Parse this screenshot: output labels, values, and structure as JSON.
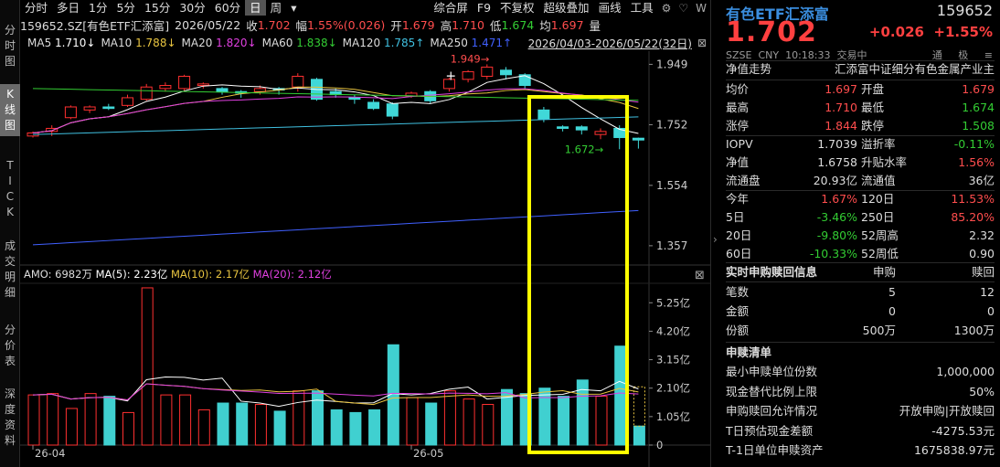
{
  "sidebar": [
    {
      "label": "分时图",
      "lines": [
        "分",
        "时",
        "图"
      ],
      "active": false
    },
    {
      "label": "K线图",
      "lines": [
        "K",
        "线",
        "图"
      ],
      "active": true
    },
    {
      "label": "TICK",
      "lines": [
        "T",
        "I",
        "C",
        "K"
      ],
      "active": false
    },
    {
      "label": "成交明细",
      "lines": [
        "成",
        "交",
        "明",
        "细"
      ],
      "active": false
    },
    {
      "label": "分价表",
      "lines": [
        "分",
        "价",
        "表"
      ],
      "active": false
    },
    {
      "label": "深度资料",
      "lines": [
        "深",
        "度",
        "资",
        "料"
      ],
      "active": false
    }
  ],
  "toolbar": {
    "periods": [
      "分时",
      "多日",
      "1分",
      "5分",
      "15分",
      "30分",
      "60分",
      "日",
      "周"
    ],
    "active_period": "日",
    "more": "▾",
    "tools": [
      "综合屏",
      "F9",
      "不复权",
      "超级叠加",
      "画线",
      "工具"
    ],
    "icons": [
      "gear-icon",
      "heart-icon",
      "w-icon"
    ]
  },
  "info": {
    "code": "159652.SZ[有色ETF汇添富]",
    "date": "2026/05/22",
    "close_label": "收",
    "close": "1.702",
    "amp_label": "幅",
    "amp": "1.55%(0.026)",
    "open_label": "开",
    "open": "1.679",
    "high_label": "高",
    "high": "1.710",
    "low_label": "低",
    "low": "1.674",
    "avg_label": "均",
    "avg": "1.697",
    "vol_label": "量"
  },
  "ma": {
    "items": [
      {
        "label": "MA5",
        "value": "1.710",
        "arrow": "↓",
        "color": "#ffffff"
      },
      {
        "label": "MA10",
        "value": "1.788",
        "arrow": "↓",
        "color": "#e8c440"
      },
      {
        "label": "MA20",
        "value": "1.820",
        "arrow": "↓",
        "color": "#e040e0"
      },
      {
        "label": "MA60",
        "value": "1.838",
        "arrow": "↓",
        "color": "#33cc33"
      },
      {
        "label": "MA120",
        "value": "1.785",
        "arrow": "↑",
        "color": "#40c0e0"
      },
      {
        "label": "MA250",
        "value": "1.471",
        "arrow": "↑",
        "color": "#4060ff"
      }
    ],
    "range": "2026/04/03-2026/05/22(32日)"
  },
  "chart_data": {
    "type": "candlestick",
    "price_ticks": [
      "1.949",
      "1.752",
      "1.554",
      "1.357"
    ],
    "vol_ticks": [
      "5.25亿",
      "4.20亿",
      "3.15亿",
      "2.10亿",
      "1.05亿",
      "0"
    ],
    "x_labels": [
      "26-04",
      "26-05"
    ],
    "high_marker": "1.949",
    "low_marker": "1.672",
    "candles": [
      {
        "o": 1.715,
        "c": 1.725,
        "h": 1.73,
        "l": 1.71,
        "v": 1.85
      },
      {
        "o": 1.73,
        "c": 1.74,
        "h": 1.75,
        "l": 1.715,
        "v": 1.9
      },
      {
        "o": 1.775,
        "c": 1.81,
        "h": 1.815,
        "l": 1.77,
        "v": 1.35
      },
      {
        "o": 1.8,
        "c": 1.81,
        "h": 1.815,
        "l": 1.79,
        "v": 1.9
      },
      {
        "o": 1.81,
        "c": 1.805,
        "h": 1.82,
        "l": 1.8,
        "v": 1.8
      },
      {
        "o": 1.815,
        "c": 1.84,
        "h": 1.85,
        "l": 1.81,
        "v": 1.2
      },
      {
        "o": 1.835,
        "c": 1.875,
        "h": 1.885,
        "l": 1.83,
        "v": 5.8
      },
      {
        "o": 1.87,
        "c": 1.88,
        "h": 1.89,
        "l": 1.86,
        "v": 1.85
      },
      {
        "o": 1.87,
        "c": 1.91,
        "h": 1.915,
        "l": 1.86,
        "v": 1.85
      },
      {
        "o": 1.88,
        "c": 1.885,
        "h": 1.89,
        "l": 1.87,
        "v": 1.3
      },
      {
        "o": 1.87,
        "c": 1.86,
        "h": 1.875,
        "l": 1.85,
        "v": 1.55
      },
      {
        "o": 1.86,
        "c": 1.855,
        "h": 1.865,
        "l": 1.84,
        "v": 1.55
      },
      {
        "o": 1.86,
        "c": 1.87,
        "h": 1.88,
        "l": 1.85,
        "v": 1.5
      },
      {
        "o": 1.87,
        "c": 1.865,
        "h": 1.875,
        "l": 1.85,
        "v": 1.25
      },
      {
        "o": 1.875,
        "c": 1.91,
        "h": 1.92,
        "l": 1.86,
        "v": 2.0
      },
      {
        "o": 1.9,
        "c": 1.835,
        "h": 1.905,
        "l": 1.83,
        "v": 2.0
      },
      {
        "o": 1.86,
        "c": 1.85,
        "h": 1.87,
        "l": 1.84,
        "v": 1.3
      },
      {
        "o": 1.84,
        "c": 1.835,
        "h": 1.85,
        "l": 1.82,
        "v": 1.2
      },
      {
        "o": 1.825,
        "c": 1.805,
        "h": 1.835,
        "l": 1.8,
        "v": 1.3
      },
      {
        "o": 1.82,
        "c": 1.78,
        "h": 1.825,
        "l": 1.77,
        "v": 3.7
      },
      {
        "o": 1.845,
        "c": 1.855,
        "h": 1.86,
        "l": 1.84,
        "v": 1.75
      },
      {
        "o": 1.86,
        "c": 1.83,
        "h": 1.865,
        "l": 1.82,
        "v": 1.55
      },
      {
        "o": 1.87,
        "c": 1.9,
        "h": 1.905,
        "l": 1.86,
        "v": 2.0
      },
      {
        "o": 1.9,
        "c": 1.925,
        "h": 1.93,
        "l": 1.89,
        "v": 1.7
      },
      {
        "o": 1.91,
        "c": 1.94,
        "h": 1.949,
        "l": 1.9,
        "v": 1.5
      },
      {
        "o": 1.93,
        "c": 1.915,
        "h": 1.94,
        "l": 1.9,
        "v": 2.05
      },
      {
        "o": 1.915,
        "c": 1.88,
        "h": 1.92,
        "l": 1.87,
        "v": 1.9
      },
      {
        "o": 1.8,
        "c": 1.77,
        "h": 1.81,
        "l": 1.76,
        "v": 2.1
      },
      {
        "o": 1.745,
        "c": 1.74,
        "h": 1.75,
        "l": 1.73,
        "v": 1.8
      },
      {
        "o": 1.745,
        "c": 1.735,
        "h": 1.75,
        "l": 1.72,
        "v": 2.4
      },
      {
        "o": 1.72,
        "c": 1.73,
        "h": 1.74,
        "l": 1.705,
        "v": 1.8
      },
      {
        "o": 1.74,
        "c": 1.71,
        "h": 1.75,
        "l": 1.672,
        "v": 3.65
      },
      {
        "o": 1.708,
        "c": 1.702,
        "h": 1.71,
        "l": 1.674,
        "v": 0.7
      }
    ]
  },
  "amo": {
    "label": "AMO:",
    "value": "6982万",
    "ma5": "MA(5): 2.23亿",
    "ma10": "MA(10): 2.17亿",
    "ma20": "MA(20): 2.12亿"
  },
  "quote": {
    "name": "有色ETF汇添富",
    "code": "159652",
    "price": "1.702",
    "change": "+0.026",
    "pct": "+1.55%",
    "exchange": "SZSE",
    "currency": "CNY",
    "time": "10:18:33",
    "status": "交易中",
    "tag1": "通",
    "tag2": "极",
    "tag3": "≡"
  },
  "nav": {
    "label": "净值走势",
    "value": "汇添富中证细分有色金属产业主"
  },
  "stats": [
    [
      "均价",
      "1.697",
      "开盘",
      "1.679"
    ],
    [
      "最高",
      "1.710",
      "最低",
      "1.674"
    ],
    [
      "涨停",
      "1.844",
      "跌停",
      "1.508"
    ],
    [
      "IOPV",
      "1.7039",
      "溢折率",
      "-0.11%"
    ],
    [
      "净值",
      "1.6758",
      "升贴水率",
      "1.56%"
    ],
    [
      "流通盘",
      "20.93亿",
      "流通值",
      "36亿"
    ],
    [
      "今年",
      "1.67%",
      "120日",
      "11.53%"
    ],
    [
      "5日",
      "-3.46%",
      "250日",
      "85.20%"
    ],
    [
      "20日",
      "-9.80%",
      "52周高",
      "2.32"
    ],
    [
      "60日",
      "-10.33%",
      "52周低",
      "0.90"
    ]
  ],
  "redeem": {
    "title": "实时申购赎回信息",
    "col1": "申购",
    "col2": "赎回",
    "rows": [
      [
        "笔数",
        "5",
        "12"
      ],
      [
        "金额",
        "0",
        "0"
      ],
      [
        "份额",
        "500万",
        "1300万"
      ]
    ]
  },
  "list": {
    "title": "申赎清单",
    "rows": [
      [
        "最小申赎单位份数",
        "1,000,000"
      ],
      [
        "现金替代比例上限",
        "50%"
      ],
      [
        "申购赎回允许情况",
        "开放申购|开放赎回"
      ],
      [
        "T日预估现金差额",
        "-4275.53元"
      ],
      [
        "T-1日单位申赎资产",
        "1675838.97元"
      ]
    ]
  }
}
